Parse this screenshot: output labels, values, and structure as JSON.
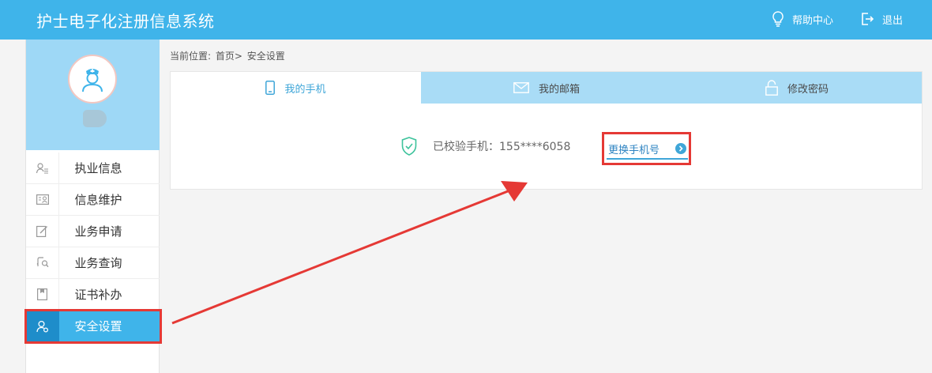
{
  "header": {
    "app_title": "护士电子化注册信息系统",
    "help_label": "帮助中心",
    "logout_label": "退出"
  },
  "sidebar": {
    "menu": [
      {
        "label": "执业信息",
        "icon": "user-list-icon"
      },
      {
        "label": "信息维护",
        "icon": "id-card-icon"
      },
      {
        "label": "业务申请",
        "icon": "edit-form-icon"
      },
      {
        "label": "业务查询",
        "icon": "search-person-icon"
      },
      {
        "label": "证书补办",
        "icon": "certificate-icon"
      },
      {
        "label": "安全设置",
        "icon": "user-shield-icon",
        "active": true
      }
    ]
  },
  "breadcrumb": {
    "prefix": "当前位置:",
    "home": "首页>",
    "current": "安全设置"
  },
  "tabs": {
    "phone": "我的手机",
    "email": "我的邮箱",
    "password": "修改密码"
  },
  "phone_panel": {
    "verified_text": "已校验手机：155****6058",
    "change_button": "更换手机号"
  },
  "colors": {
    "header_bg": "#3fb4ea",
    "active_menu": "#3fb4ea",
    "tab_inactive": "#a9dcf6",
    "annotation": "#e53935"
  }
}
